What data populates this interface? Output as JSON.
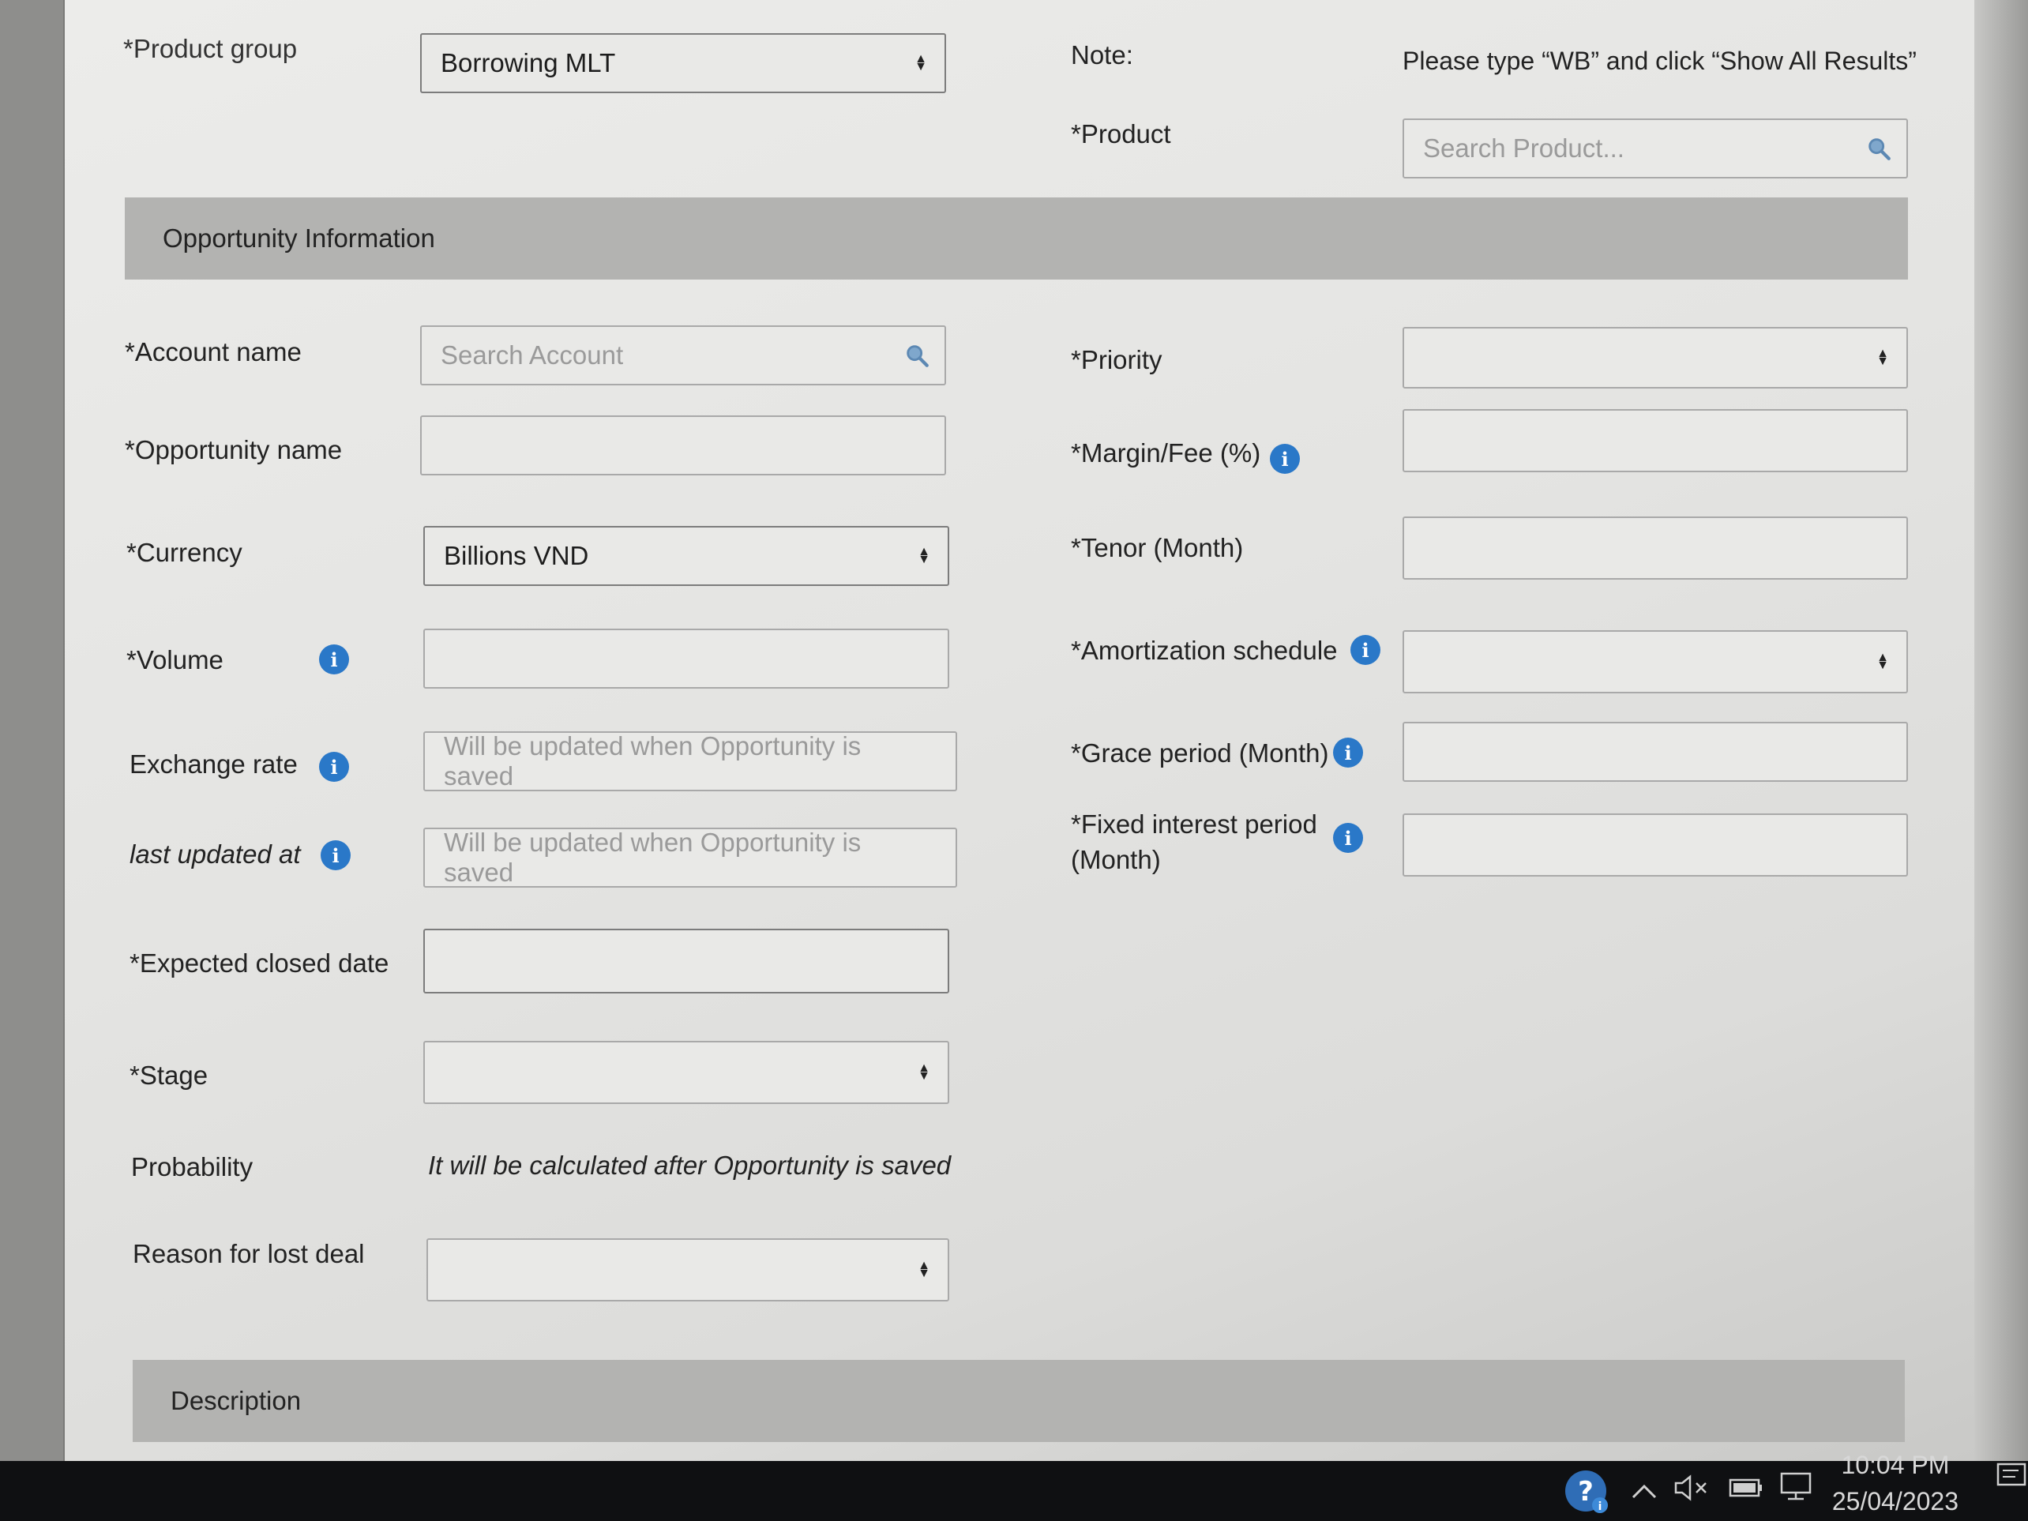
{
  "form": {
    "product_group": {
      "label": "*Product group",
      "value": "Borrowing MLT"
    },
    "note": {
      "label": "Note:",
      "text": "Please type “WB” and click “Show All Results”"
    },
    "product": {
      "label": "*Product",
      "placeholder": "Search Product..."
    }
  },
  "sections": {
    "opportunity": "Opportunity Information",
    "description": "Description"
  },
  "left_fields": {
    "account_name": {
      "label": "*Account name",
      "placeholder": "Search Account"
    },
    "opportunity_name": {
      "label": "*Opportunity name",
      "value": ""
    },
    "currency": {
      "label": "*Currency",
      "value": "Billions VND"
    },
    "volume": {
      "label": "*Volume",
      "value": ""
    },
    "exchange_rate": {
      "label": "Exchange rate",
      "placeholder": "Will be updated when Opportunity is saved"
    },
    "last_updated": {
      "label": "last updated at",
      "placeholder": "Will be updated when Opportunity is saved"
    },
    "expected_closed_date": {
      "label": "*Expected closed date",
      "value": ""
    },
    "stage": {
      "label": "*Stage",
      "value": ""
    },
    "probability": {
      "label": "Probability",
      "text": "It will be calculated after Opportunity is saved"
    },
    "reason_lost": {
      "label": "Reason for lost deal",
      "value": ""
    }
  },
  "right_fields": {
    "priority": {
      "label": "*Priority",
      "value": ""
    },
    "margin_fee": {
      "label": "*Margin/Fee (%)",
      "value": ""
    },
    "tenor": {
      "label": "*Tenor (Month)",
      "value": ""
    },
    "amortization": {
      "label": "*Amortization schedule",
      "value": ""
    },
    "grace_period": {
      "label": "*Grace period (Month)",
      "value": ""
    },
    "fixed_interest_line1": "*Fixed interest period",
    "fixed_interest_line2": "(Month)"
  },
  "taskbar": {
    "time": "10:04 PM",
    "date": "25/04/2023"
  },
  "colors": {
    "info_icon": "#2a78c8",
    "section_bg": "#b3b3b1",
    "taskbar_bg": "#0f1012"
  }
}
